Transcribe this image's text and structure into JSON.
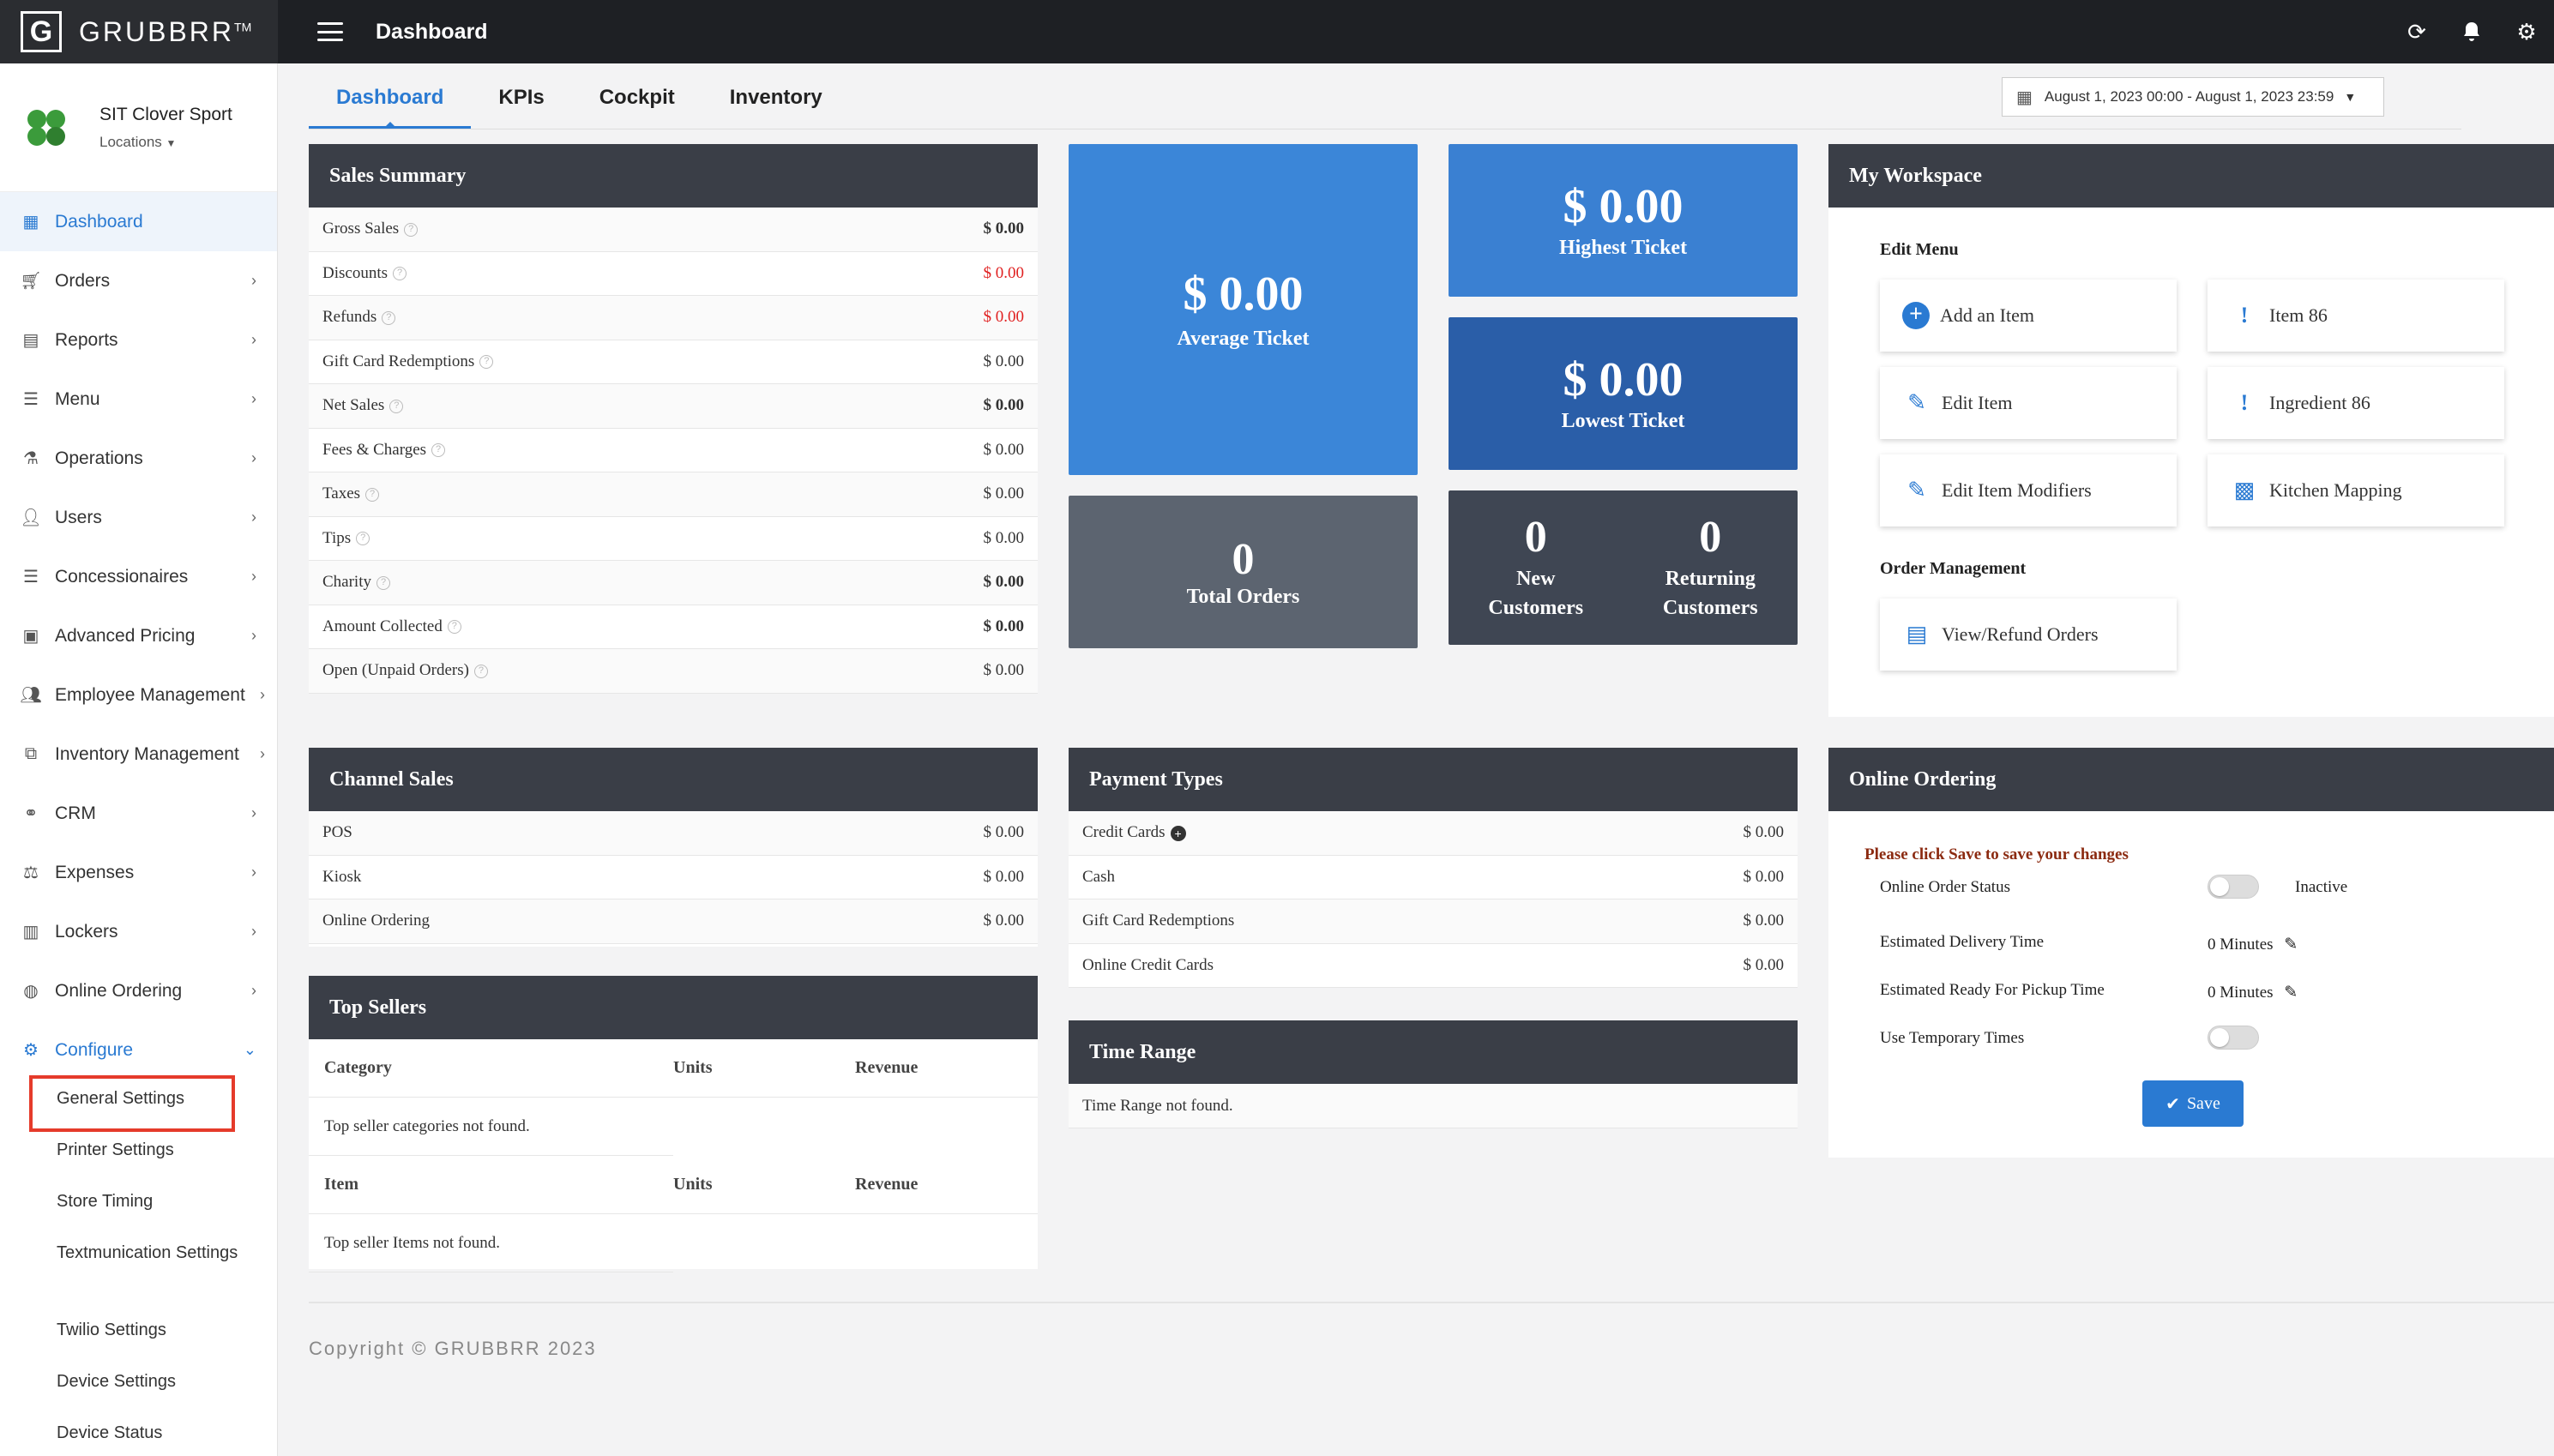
{
  "brand": {
    "logo_letter": "G",
    "name": "GRUBBRR",
    "tm": "TM"
  },
  "topbar": {
    "title": "Dashboard"
  },
  "store": {
    "name": "SIT Clover Sport",
    "locations_label": "Locations"
  },
  "sidebar": {
    "items": [
      {
        "label": "Dashboard",
        "icon": "dashboard-icon"
      },
      {
        "label": "Orders",
        "icon": "cart-icon"
      },
      {
        "label": "Reports",
        "icon": "report-icon"
      },
      {
        "label": "Menu",
        "icon": "list-icon"
      },
      {
        "label": "Operations",
        "icon": "flask-icon"
      },
      {
        "label": "Users",
        "icon": "user-icon"
      },
      {
        "label": "Concessionaires",
        "icon": "list-icon"
      },
      {
        "label": "Advanced Pricing",
        "icon": "money-icon"
      },
      {
        "label": "Employee Management",
        "icon": "users-icon"
      },
      {
        "label": "Inventory Management",
        "icon": "sitemap-icon"
      },
      {
        "label": "CRM",
        "icon": "link-icon"
      },
      {
        "label": "Expenses",
        "icon": "scale-icon"
      },
      {
        "label": "Lockers",
        "icon": "lockers-icon"
      },
      {
        "label": "Online Ordering",
        "icon": "globe-icon"
      },
      {
        "label": "Configure",
        "icon": "gear-icon"
      }
    ],
    "configure_sub": [
      "General Settings",
      "Printer Settings",
      "Store Timing",
      "Textmunication Settings",
      "Twilio Settings",
      "Device Settings",
      "Device Status"
    ]
  },
  "tabs": [
    "Dashboard",
    "KPIs",
    "Cockpit",
    "Inventory"
  ],
  "date_range": "August 1, 2023 00:00 - August 1, 2023 23:59",
  "sales_summary": {
    "title": "Sales Summary",
    "rows": [
      {
        "label": "Gross Sales",
        "value": "$ 0.00",
        "style": "bold"
      },
      {
        "label": "Discounts",
        "value": "$ 0.00",
        "style": "red"
      },
      {
        "label": "Refunds",
        "value": "$ 0.00",
        "style": "red"
      },
      {
        "label": "Gift Card Redemptions",
        "value": "$ 0.00",
        "style": ""
      },
      {
        "label": "Net Sales",
        "value": "$ 0.00",
        "style": "bold"
      },
      {
        "label": "Fees & Charges",
        "value": "$ 0.00",
        "style": ""
      },
      {
        "label": "Taxes",
        "value": "$ 0.00",
        "style": ""
      },
      {
        "label": "Tips",
        "value": "$ 0.00",
        "style": ""
      },
      {
        "label": "Charity",
        "value": "$ 0.00",
        "style": "bold"
      },
      {
        "label": "Amount Collected",
        "value": "$ 0.00",
        "style": "bold"
      },
      {
        "label": "Open (Unpaid Orders)",
        "value": "$ 0.00",
        "style": ""
      }
    ]
  },
  "tiles": {
    "average": {
      "value": "$ 0.00",
      "label": "Average Ticket"
    },
    "highest": {
      "value": "$ 0.00",
      "label": "Highest Ticket"
    },
    "lowest": {
      "value": "$ 0.00",
      "label": "Lowest Ticket"
    },
    "total_orders": {
      "value": "0",
      "label": "Total Orders"
    },
    "new_customers": {
      "value": "0",
      "label_1": "New",
      "label_2": "Customers"
    },
    "returning_customers": {
      "value": "0",
      "label_1": "Returning",
      "label_2": "Customers"
    }
  },
  "workspace": {
    "title": "My Workspace",
    "edit_menu_label": "Edit Menu",
    "buttons": [
      "Add an Item",
      "Item 86",
      "Edit Item",
      "Ingredient 86",
      "Edit Item Modifiers",
      "Kitchen Mapping"
    ],
    "order_mgmt_label": "Order Management",
    "order_buttons": [
      "View/Refund Orders"
    ]
  },
  "channel_sales": {
    "title": "Channel Sales",
    "rows": [
      {
        "label": "POS",
        "value": "$ 0.00"
      },
      {
        "label": "Kiosk",
        "value": "$ 0.00"
      },
      {
        "label": "Online Ordering",
        "value": "$ 0.00"
      }
    ]
  },
  "payment_types": {
    "title": "Payment Types",
    "rows": [
      {
        "label": "Credit Cards",
        "value": "$ 0.00"
      },
      {
        "label": "Cash",
        "value": "$ 0.00"
      },
      {
        "label": "Gift Card Redemptions",
        "value": "$ 0.00"
      },
      {
        "label": "Online Credit Cards",
        "value": "$ 0.00"
      }
    ]
  },
  "top_sellers": {
    "title": "Top Sellers",
    "cat_header": [
      "Category",
      "Units",
      "Revenue"
    ],
    "cat_empty": "Top seller categories not found.",
    "item_header": [
      "Item",
      "Units",
      "Revenue"
    ],
    "item_empty": "Top seller Items not found."
  },
  "time_range": {
    "title": "Time Range",
    "empty": "Time Range not found."
  },
  "online_ordering": {
    "title": "Online Ordering",
    "notice": "Please click Save to save your changes",
    "status_label": "Online Order Status",
    "status_value": "Inactive",
    "delivery_label": "Estimated Delivery Time",
    "delivery_value": "0 Minutes",
    "pickup_label": "Estimated Ready For Pickup Time",
    "pickup_value": "0 Minutes",
    "temp_label": "Use Temporary Times",
    "save_label": "Save"
  },
  "footer": "Copyright © GRUBBRR 2023",
  "colors": {
    "accent": "#2a7ad2",
    "tile_blue": "#3b86d8",
    "tile_dark_blue": "#2a5ea8",
    "tile_gray": "#5c6470",
    "tile_dark": "#3f4653",
    "header": "#3a3e47"
  }
}
